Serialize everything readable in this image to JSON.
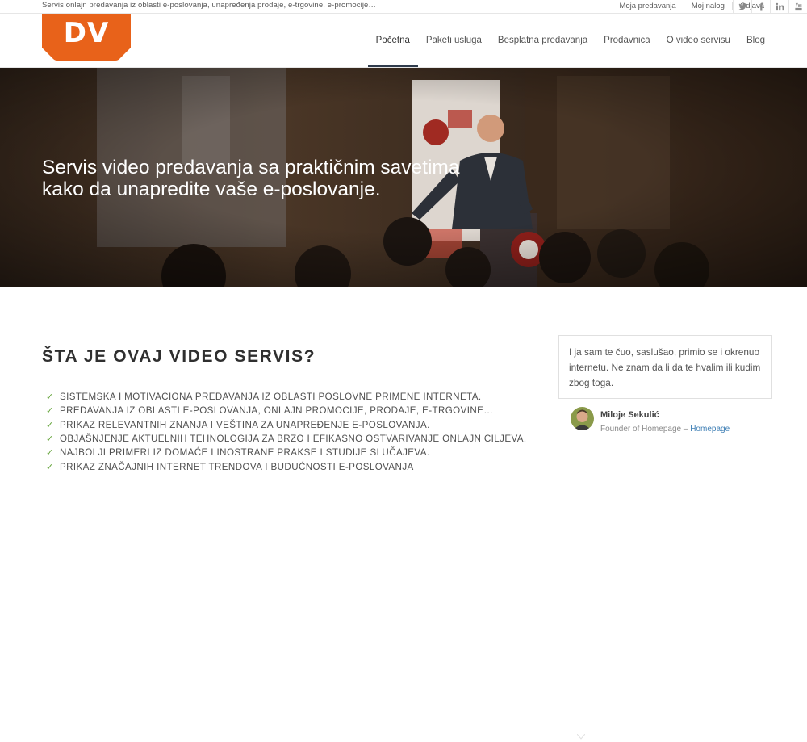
{
  "topbar": {
    "tagline": "Servis onlajn predavanja iz oblasti e-poslovanja, unapređenja prodaje, e-trgovine, e-promocije…",
    "links": [
      "Moja predavanja",
      "Moj nalog",
      "Odjava"
    ],
    "social_icons": [
      "twitter-icon",
      "facebook-icon",
      "linkedin-icon",
      "youtube-icon"
    ]
  },
  "header": {
    "logo_text": "DV",
    "logo_color": "#e8621a",
    "nav": [
      "Početna",
      "Paketi usluga",
      "Besplatna predavanja",
      "Prodavnica",
      "O video servisu",
      "Blog"
    ],
    "active_nav": "Početna"
  },
  "hero": {
    "title_line1": "Servis video predavanja sa praktičnim savetima",
    "title_line2": "kako da unapredite vaše e-poslovanje."
  },
  "main": {
    "title": "ŠTA JE OVAJ VIDEO SERVIS?",
    "accent_color": "#5a9e2d",
    "items": [
      "SISTEMSKA I MOTIVACIONA PREDAVANJA IZ OBLASTI POSLOVNE PRIMENE INTERNETA.",
      "PREDAVANJA IZ OBLASTI E-POSLOVANJA, ONLAJN PROMOCIJE, PRODAJE, E-TRGOVINE…",
      "PRIKAZ RELEVANTNIH ZNANJA I VEŠTINA ZA UNAPREĐENJE E-POSLOVANJA.",
      "OBJAŠNJENJE AKTUELNIH TEHNOLOGIJA ZA BRZO I EFIKASNO OSTVARIVANJE ONLAJN CILJEVA.",
      "NAJBOLJI PRIMERI IZ DOMAĆE I INOSTRANE PRAKSE I STUDIJE SLUČAJEVA.",
      "PRIKAZ ZNAČAJNIH INTERNET TRENDOVA I BUDUĆNOSTI E-POSLOVANJA"
    ]
  },
  "testimonial": {
    "quote": "I ja sam te čuo, saslušao, primio se i okrenuo internetu. Ne znam da li da te hvalim ili kudim zbog toga.",
    "author": "Miloje Sekulić",
    "role": "Founder of Homepage",
    "separator": " – ",
    "link": "Homepage"
  }
}
